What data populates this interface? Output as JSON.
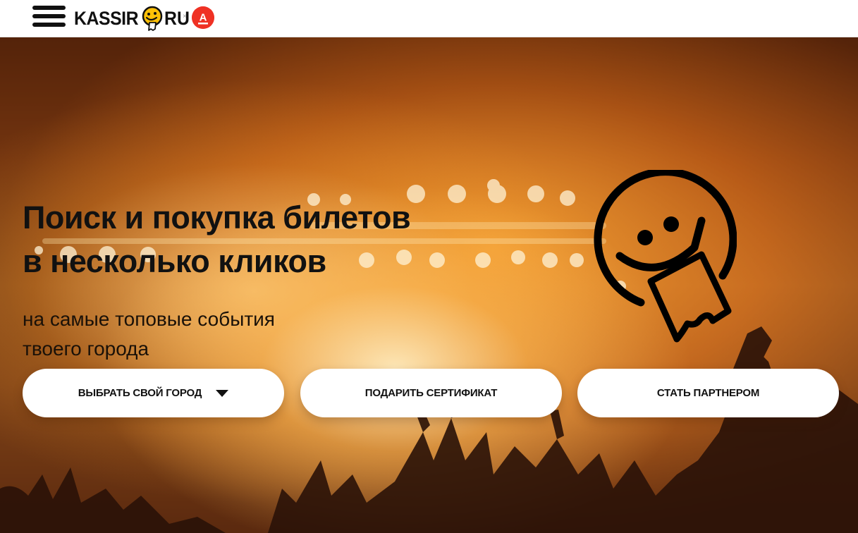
{
  "header": {
    "menu_icon": "hamburger-menu-icon",
    "logo": {
      "text_left": "KASSIR",
      "text_right": "RU",
      "icon": "smiley-ticket-icon"
    },
    "partner_separator": "×",
    "partner_logo_icon": "alfa-bank-logo-icon",
    "partner_logo_letter": "А",
    "partner_color": "#ef3124"
  },
  "hero": {
    "title_line1": "Поиск и покупка билетов",
    "title_line2": "в несколько кликов",
    "subtitle_line1": "на самые топовые события",
    "subtitle_line2": "твоего города",
    "illustration_icon": "smiley-ticket-icon",
    "background": "concert-crowd-photo"
  },
  "actions": {
    "choose_city_label": "ВЫБРАТЬ СВОЙ ГОРОД",
    "choose_city_icon": "caret-down-icon",
    "gift_certificate_label": "ПОДАРИТЬ СЕРТИФИКАТ",
    "become_partner_label": "СТАТЬ ПАРТНЕРОМ"
  },
  "colors": {
    "header_bg": "#ffffff",
    "text_dark": "#111111",
    "button_bg": "#ffffff",
    "hero_tone": "#d98a33"
  }
}
